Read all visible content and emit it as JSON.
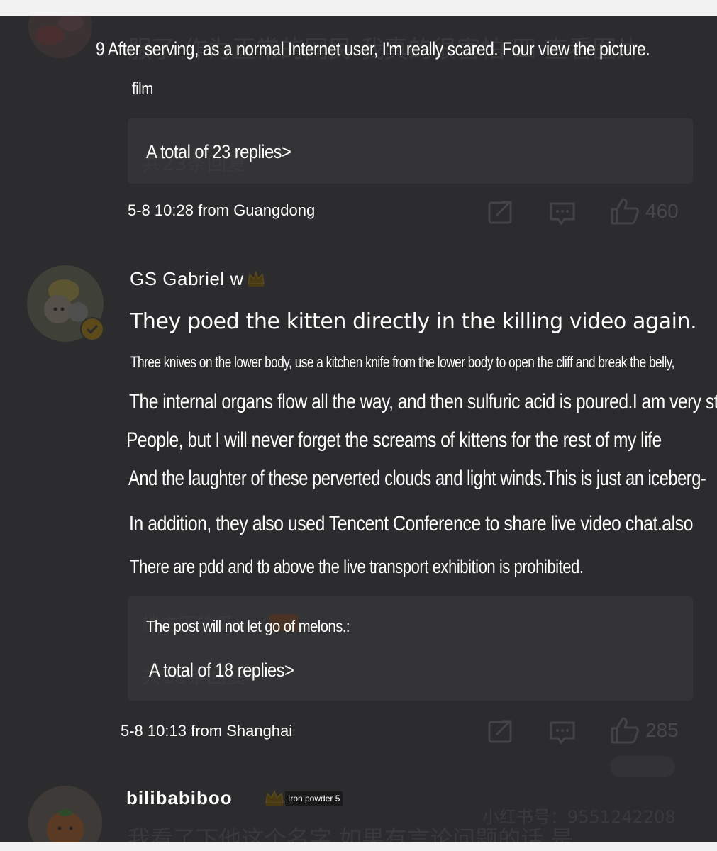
{
  "comments": [
    {
      "line1": "9 After serving, as a normal Internet user, I'm really scared. Four view the picture.",
      "line2": "film",
      "replies_link": "A total of 23 replies>",
      "meta": "5-8 10:28 from Guangdong",
      "likes": "460"
    },
    {
      "username": "GS Gabriel w",
      "headline": "They poed the kitten directly in the killing video again.",
      "body_lines": [
        "Three knives on the lower body, use a kitchen knife from the lower body to open the cliff and break the belly,",
        "The internal organs flow all the way, and then sulfuric acid is poured.I am very strong",
        "People, but I will never forget the screams of kittens for the rest of my life",
        "And the laughter of these perverted clouds and light winds.This is just an iceberg-",
        "In addition, they also used Tencent Conference to share live video chat.also",
        "There are pdd and tb above the live transport exhibition is prohibited."
      ],
      "reply_preview": "The post will not let go of melons.:",
      "replies_link": "A total of 18 replies>",
      "meta": "5-8 10:13 from Shanghai",
      "likes": "285"
    },
    {
      "username": "bilibabiboo",
      "badge": "Iron powder 5",
      "ghost_id": "小红书号：9551242208",
      "ghost_body": "我看了下他这个名字 如果有言论问题的话 是"
    }
  ],
  "ghost_text": {
    "top_line": "服了 作为正常的网民 我真的很害怕 四 查看图片",
    "top_replies": "共23条回复",
    "mid_replies": "共18条回复",
    "mid_preview": "楼主不放瓜"
  },
  "colors": {
    "overlay": "#2c2c2e",
    "text": "#ffffff",
    "icon": "#444446"
  }
}
